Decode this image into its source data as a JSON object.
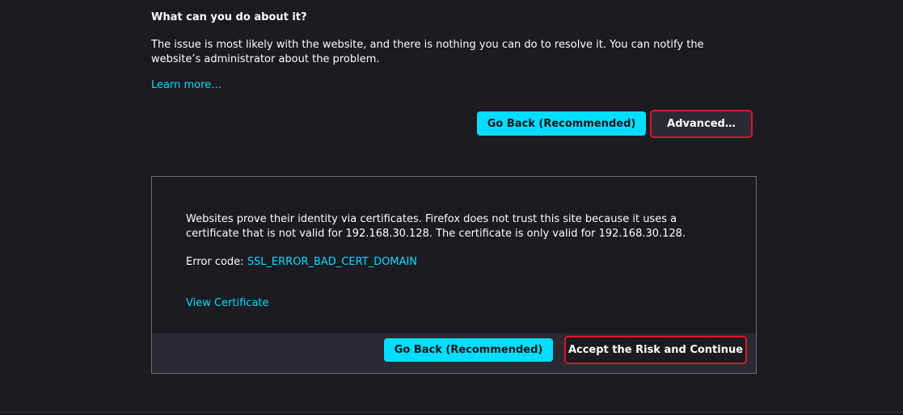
{
  "what_can_you_do": {
    "heading": "What can you do about it?",
    "paragraph": "The issue is most likely with the website, and there is nothing you can do to resolve it. You can notify the website’s administrator about the problem.",
    "learn_more": "Learn more…"
  },
  "actions": {
    "go_back_label": "Go Back (Recommended)",
    "advanced_label": "Advanced…"
  },
  "advanced_panel": {
    "description": "Websites prove their identity via certificates. Firefox does not trust this site because it uses a certificate that is not valid for 192.168.30.128. The certificate is only valid for 192.168.30.128.",
    "error_code_prefix": "Error code: ",
    "error_code": "SSL_ERROR_BAD_CERT_DOMAIN",
    "view_certificate": "View Certificate",
    "go_back_label": "Go Back (Recommended)",
    "accept_label": "Accept the Risk and Continue"
  },
  "colors": {
    "background": "#1c1b22",
    "accent": "#00ddff",
    "highlight_outline": "#e0152a",
    "footer_bg": "#2b2a33"
  }
}
